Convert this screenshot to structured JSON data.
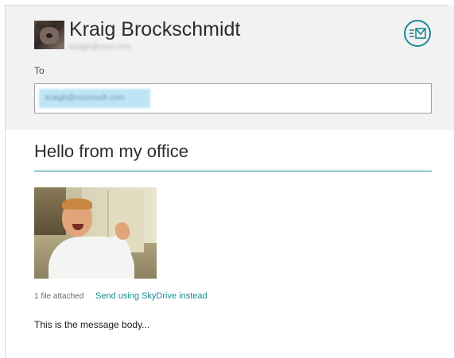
{
  "compose": {
    "sender": {
      "name": "Kraig Brockschmidt",
      "email": "kraigb@msn.com"
    },
    "send_icon": "send-mail-icon",
    "to_label": "To",
    "recipient": "kraigb@microsoft.com",
    "subject": "Hello from my office",
    "attachment": {
      "count_text": "1 file attached",
      "skydrive_link": "Send using SkyDrive instead"
    },
    "body_text": "This is the message body...",
    "colors": {
      "accent": "#1a8796",
      "header_background": "#f2f2f2",
      "recipient_chip": "#bfe4f6"
    }
  }
}
